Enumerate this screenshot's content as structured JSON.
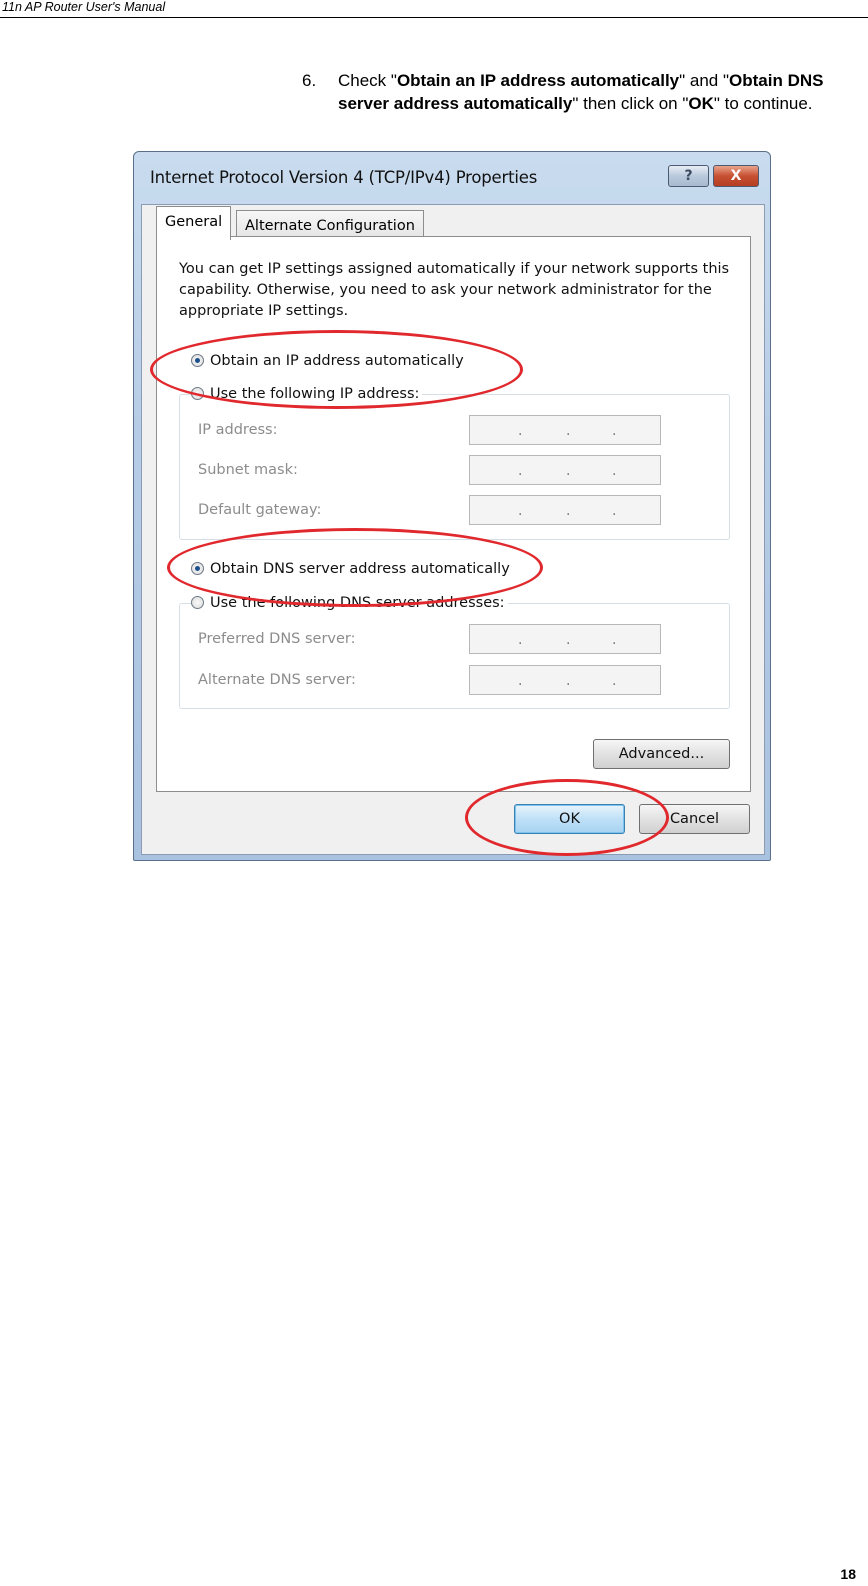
{
  "header": {
    "title": "11n AP Router User's Manual"
  },
  "instruction": {
    "number": "6.",
    "parts": [
      {
        "text": "Check \"",
        "bold": false
      },
      {
        "text": "Obtain an IP address automatically",
        "bold": true
      },
      {
        "text": "\" and \"",
        "bold": false
      },
      {
        "text": "Obtain DNS server address automatically",
        "bold": true
      },
      {
        "text": "\" then click on \"",
        "bold": false
      },
      {
        "text": "OK",
        "bold": true
      },
      {
        "text": "\" to continue.",
        "bold": false
      }
    ]
  },
  "dialog": {
    "title": "Internet Protocol Version 4 (TCP/IPv4) Properties",
    "help_label": "?",
    "close_label": "X",
    "tabs": [
      "General",
      "Alternate Configuration"
    ],
    "active_tab": "General",
    "description": "You can get IP settings assigned automatically if your network supports this capability. Otherwise, you need to ask your network administrator for the appropriate IP settings.",
    "ip_auto_label": "Obtain an IP address automatically",
    "ip_manual_label": "Use the following IP address:",
    "ip_fields": [
      {
        "label": "IP address:",
        "value": ". . ."
      },
      {
        "label": "Subnet mask:",
        "value": ". . ."
      },
      {
        "label": "Default gateway:",
        "value": ". . ."
      }
    ],
    "dns_auto_label": "Obtain DNS server address automatically",
    "dns_manual_label": "Use the following DNS server addresses:",
    "dns_fields": [
      {
        "label": "Preferred DNS server:",
        "value": ". . ."
      },
      {
        "label": "Alternate DNS server:",
        "value": ". . ."
      }
    ],
    "advanced_label": "Advanced...",
    "ok_label": "OK",
    "cancel_label": "Cancel"
  },
  "highlight_color": "#e0282d",
  "page_number": "18"
}
